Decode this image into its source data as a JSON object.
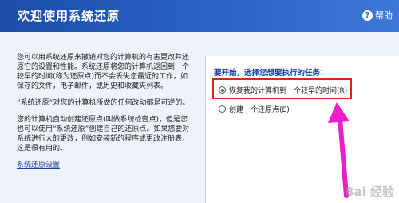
{
  "header": {
    "title": "欢迎使用系统还原",
    "help_glyph": "?",
    "help_label": "帮助"
  },
  "intro": {
    "para1": "您可以用系统还原来撤销对您的计算机的有害更改并还原它的设置和性能。系统还原将您的计算机返回到一个较早的时间(称为还原点)而不会丢失您最近的工作，如保存的文件，电子邮件，或历史和收藏夹列表。",
    "para2": "“系统还原”对您的计算机所做的任何改动都是可逆的。",
    "para3": "您的计算机自动创建还原点(叫做系统检查点)，但是您也可以使用“系统还原”创建自己的还原点。如果您要对系统进行大的更改，例如安装新的程序或更改注册表，这是很有用的。",
    "settings_link": "系统还原设置"
  },
  "task": {
    "prompt": "要开始，选择您想要执行的任务：",
    "options": [
      {
        "label": "恢复我的计算机到一个较早的时间(R)",
        "checked": true
      },
      {
        "label": "创建一个还原点(E)",
        "checked": false
      }
    ]
  },
  "annotation": {
    "highlight_color": "#e0231d",
    "arrow_color": "#ea1fc9"
  },
  "watermark": "Bai 经验"
}
